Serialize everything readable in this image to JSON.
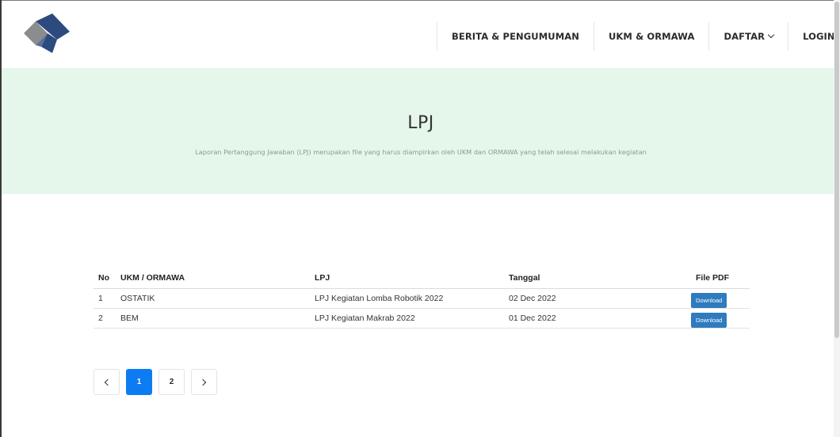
{
  "nav": {
    "items": [
      {
        "label": "BERITA & PENGUMUMAN"
      },
      {
        "label": "UKM & ORMAWA"
      },
      {
        "label": "DAFTAR"
      },
      {
        "label": "LOGIN"
      }
    ]
  },
  "hero": {
    "title": "LPJ",
    "subtitle": "Laporan Pertanggung Jawaban (LPJ) merupakan file yang harus diampirkan oleh UKM dan ORMAWA yang telah selesai melakukan kegiatan"
  },
  "table": {
    "headers": [
      "No",
      "UKM / ORMAWA",
      "LPJ",
      "Tanggal",
      "File PDF"
    ],
    "rows": [
      {
        "no": "1",
        "ukm": "OSTATIK",
        "lpj": "LPJ Kegiatan Lomba Robotik 2022",
        "tanggal": "02 Dec 2022",
        "button": "Download"
      },
      {
        "no": "2",
        "ukm": "BEM",
        "lpj": "LPJ Kegiatan Makrab 2022",
        "tanggal": "01 Dec 2022",
        "button": "Download"
      }
    ]
  },
  "pagination": {
    "pages": [
      "1",
      "2"
    ],
    "active": "1"
  },
  "colors": {
    "hero_bg": "#e5f6eb",
    "download_button": "#2f7bbf",
    "active_page": "#0d7cf2",
    "logo_dark": "#2d4a7e",
    "logo_gray": "#8a8c8e"
  }
}
